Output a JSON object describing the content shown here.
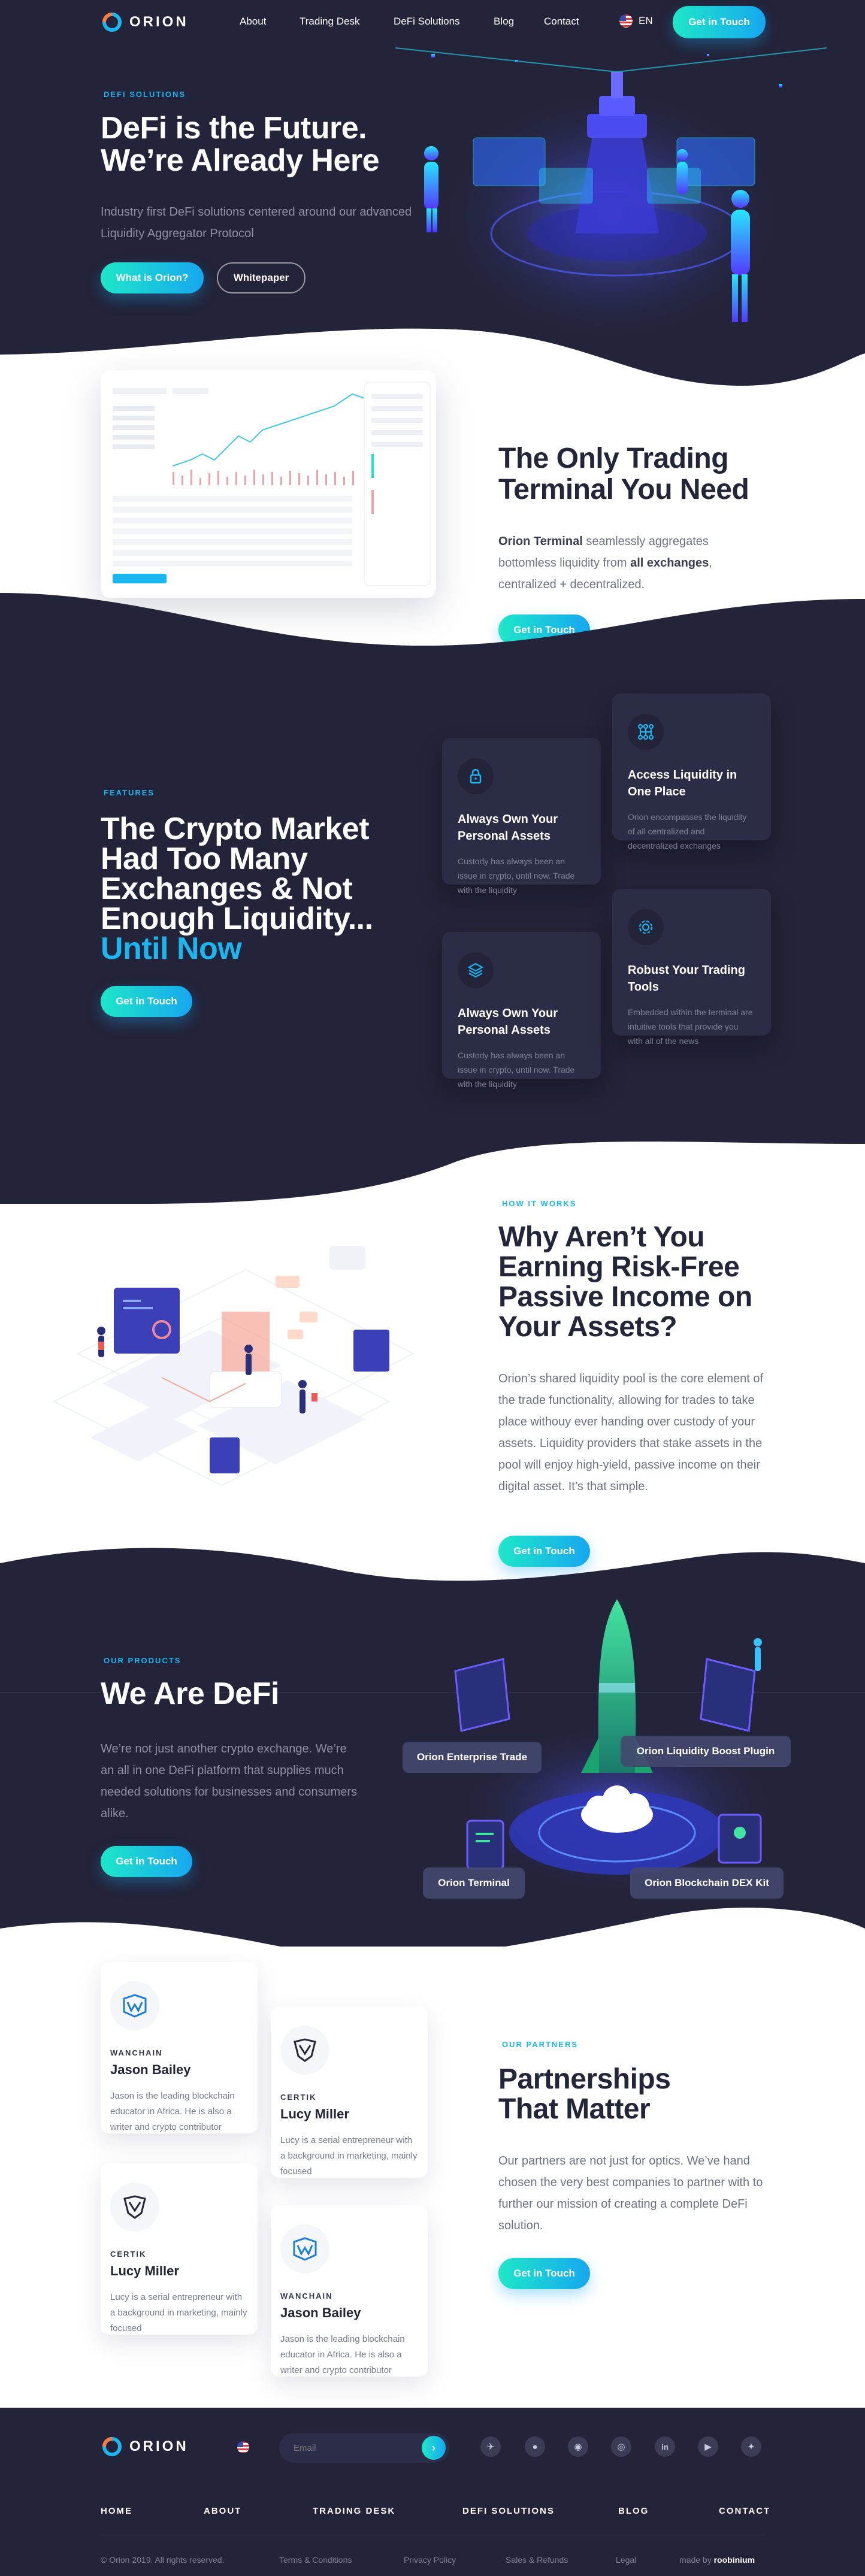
{
  "brand": {
    "name": "ORION",
    "accent": "#1ab6f0",
    "dark": "#232339"
  },
  "nav": {
    "items": [
      "About",
      "Trading Desk",
      "DeFi Solutions",
      "Blog",
      "Contact"
    ],
    "lang": "EN",
    "cta": "Get in Touch"
  },
  "hero": {
    "kicker": "DEFI SOLUTIONS",
    "title_1": "DeFi is the Future.",
    "title_2": "We’re Already Here",
    "text": "Industry first DeFi solutions centered around our advanced Liquidity Aggregator Protocol",
    "btn_primary": "What is Orion?",
    "btn_secondary": "Whitepaper"
  },
  "terminal": {
    "title_1": "The Only Trading",
    "title_2": "Terminal You Need",
    "text_bold_1": "Orion Terminal",
    "text_1": " seamlessly aggregates bottomless liquidity from ",
    "text_bold_2": "all exchanges",
    "text_2": ", centralized + decentralized.",
    "btn": "Get in Touch"
  },
  "features": {
    "kicker": "FEATURES",
    "title_1": "The Crypto Market",
    "title_2": "Had Too Many",
    "title_3": "Exchanges & Not",
    "title_4": "Enough Liquidity...",
    "title_5": "Until Now",
    "btn": "Get in Touch",
    "cards": [
      {
        "icon": "lock-icon",
        "title": "Always Own Your Personal Assets",
        "text": "Custody has always been an issue in crypto, until now. Trade with the liquidity"
      },
      {
        "icon": "network-icon",
        "title": "Access Liquidity in One Place",
        "text": "Orion encompasses the liquidity of all centralized and decentralized exchanges"
      },
      {
        "icon": "layers-icon",
        "title": "Always Own Your Personal Assets",
        "text": "Custody has always been an issue in crypto, until now. Trade with the liquidity"
      },
      {
        "icon": "gear-icon",
        "title": "Robust Your Trading Tools",
        "text": "Embedded within the terminal are intuitive tools that provide you with all of the news"
      }
    ]
  },
  "how": {
    "kicker": "HOW IT WORKS",
    "title_1": "Why Aren’t You",
    "title_2": "Earning Risk-Free",
    "title_3": "Passive Income on",
    "title_4": "Your Assets?",
    "text": "Orion’s shared liquidity pool is the core element of the trade functionality, allowing for trades to take place withouy ever handing over custody of your assets. Liquidity providers that stake assets in the pool will enjoy high-yield, passive income on their digital asset. It’s that simple.",
    "btn": "Get in Touch"
  },
  "products": {
    "kicker": "OUR PRODUCTS",
    "title": "We Are DeFi",
    "text": "We’re not just another crypto exchange. We’re an all in one DeFi platform that supplies much needed solutions for businesses and consumers alike.",
    "btn": "Get in Touch",
    "tags": [
      "Orion Enterprise Trade",
      "Orion Liquidity Boost Plugin",
      "Orion Terminal",
      "Orion Blockchain DEX Kit"
    ]
  },
  "partners": {
    "kicker": "OUR PARTNERS",
    "title_1": "Partnerships",
    "title_2": "That Matter",
    "text": "Our partners are not just for optics. We’ve hand chosen the very best companies to partner with to further our mission of creating a complete DeFi solution.",
    "btn": "Get in Touch",
    "cards": [
      {
        "company": "WANCHAIN",
        "name": "Jason Bailey",
        "text": "Jason is the leading blockchain educator in Africa. He is also a writer and crypto contributor"
      },
      {
        "company": "CERTIK",
        "name": "Lucy Miller",
        "text": "Lucy is a serial entrepreneur with a background in marketing, mainly focused"
      },
      {
        "company": "CERTIK",
        "name": "Lucy Miller",
        "text": "Lucy is a serial entrepreneur with a background in marketing, mainly focused"
      },
      {
        "company": "WANCHAIN",
        "name": "Jason Bailey",
        "text": "Jason is the leading blockchain educator in Africa. He is also a writer and crypto contributor"
      }
    ]
  },
  "footer": {
    "email_placeholder": "Email",
    "links": [
      "HOME",
      "ABOUT",
      "TRADING DESK",
      "DEFI SOLUTIONS",
      "BLOG",
      "CONTACT"
    ],
    "copyright": "© Orion 2019. All rights reserved.",
    "legal": [
      "Terms & Conditions",
      "Privacy Policy",
      "Sales & Refunds",
      "Legal"
    ],
    "made_by_label": "made by",
    "made_by": "roobinium",
    "socials": [
      "telegram-icon",
      "reddit-icon",
      "medium-icon",
      "github-icon",
      "linkedin-icon",
      "youtube-icon",
      "twitter-icon"
    ]
  }
}
